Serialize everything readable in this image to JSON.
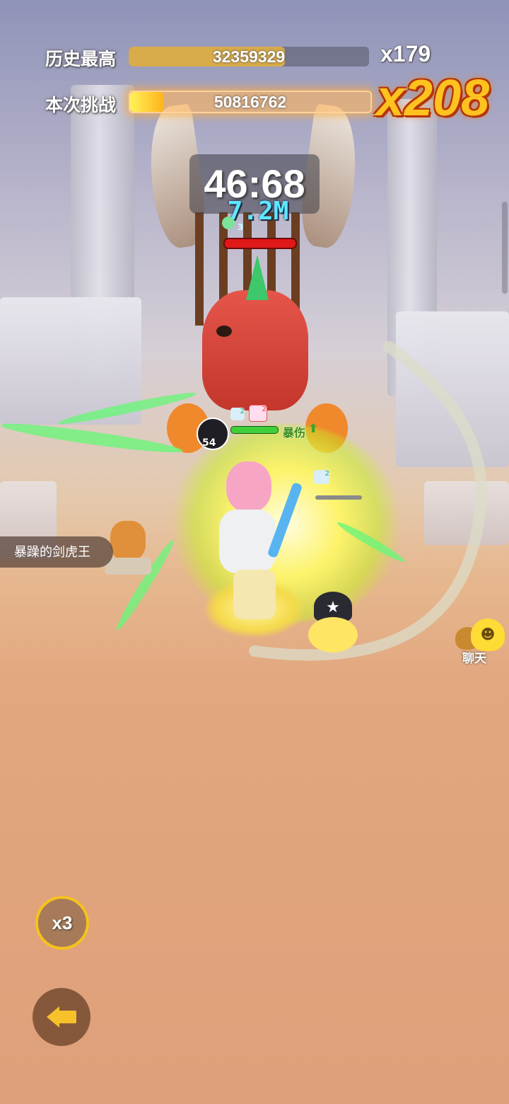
{
  "hud": {
    "best_label": "历史最高",
    "best_score": "32359329",
    "best_progress": 0.65,
    "best_multiplier": "x179",
    "current_label": "本次挑战",
    "current_score": "50816762",
    "current_progress": 0.14,
    "current_multiplier": "x208"
  },
  "boss": {
    "timer": "46:68",
    "damage": "7.2M",
    "shield_stack": "3"
  },
  "player": {
    "level": "54",
    "buff_label": "暴伤",
    "buff_stack_a": "2",
    "buff_stack_b": "2",
    "ally_buff_stack": "2"
  },
  "npc": {
    "name": "暴躁的剑虎王"
  },
  "controls": {
    "speed_label": "x3",
    "chat_label": "聊天"
  },
  "colors": {
    "multiplier": "#ffc21f",
    "damage_text": "#5ee8ff",
    "hp_bar": "#e01818",
    "player_hp": "#3ecf3a"
  },
  "icons": {
    "back": "back-arrow-icon",
    "chat": "chat-bubbles-icon",
    "shield": "shield-icon",
    "buff_up": "up-arrow-icon"
  }
}
